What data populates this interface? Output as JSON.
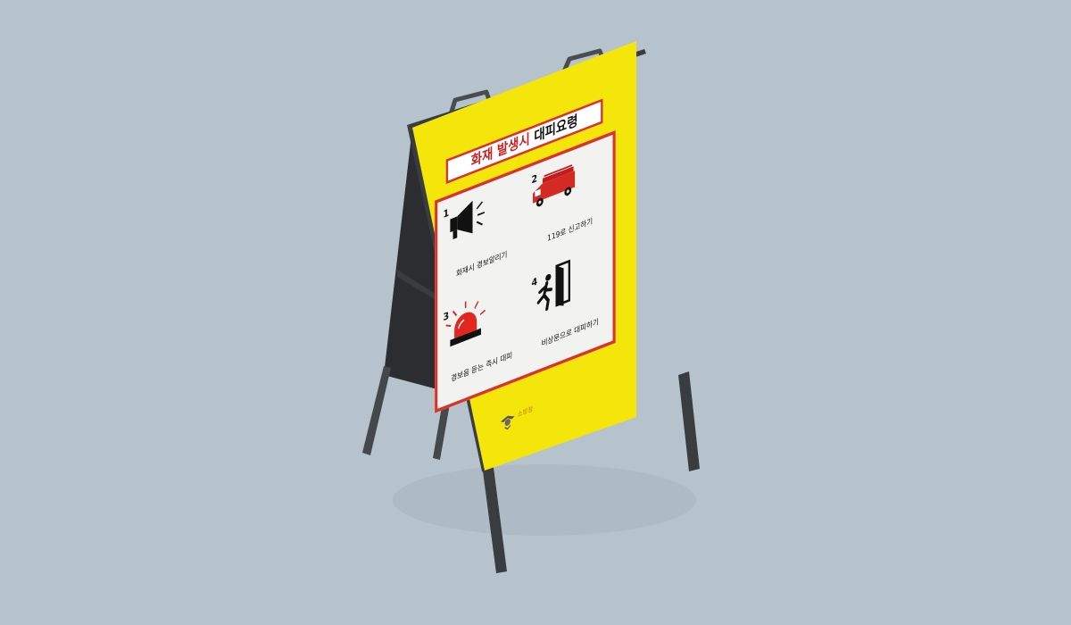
{
  "sign": {
    "title_red": "화재 발생시",
    "title_black": "대피요령",
    "steps": [
      {
        "number": "1",
        "label": "화재시 경보알리기",
        "icon": "megaphone-icon"
      },
      {
        "number": "2",
        "label": "119로 신고하기",
        "icon": "fire-truck-icon"
      },
      {
        "number": "3",
        "label": "경보음 듣는 즉시 대피",
        "icon": "siren-icon"
      },
      {
        "number": "4",
        "label": "비상문으로 대피하기",
        "icon": "emergency-exit-icon"
      }
    ],
    "logo_text": "소방청"
  },
  "colors": {
    "background": "#b7c3cc",
    "board": "#f4e50a",
    "accent_red": "#d8342a",
    "frame": "#3a3d40"
  }
}
